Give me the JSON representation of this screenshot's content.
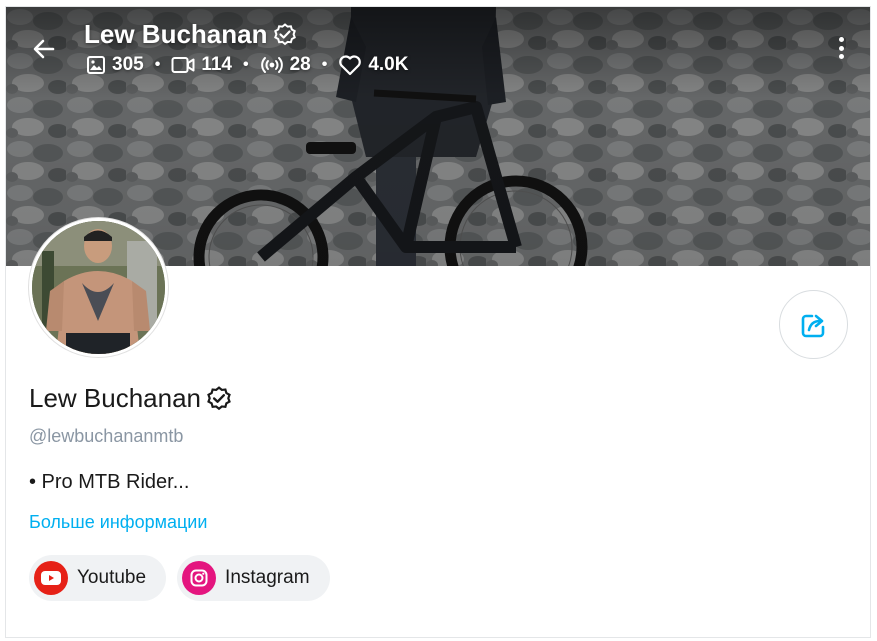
{
  "header": {
    "name": "Lew Buchanan",
    "stats": {
      "photos": "305",
      "videos": "114",
      "streams": "28",
      "likes": "4.0K"
    },
    "stat_separator": "•"
  },
  "profile": {
    "name": "Lew Buchanan",
    "handle": "@lewbuchananmtb",
    "bio": "• Pro MTB Rider...",
    "more_info": "Больше информации"
  },
  "socials": [
    {
      "label": "Youtube",
      "icon": "youtube-icon",
      "color": "#e62117"
    },
    {
      "label": "Instagram",
      "icon": "instagram-icon",
      "color": "#e4157f"
    }
  ],
  "colors": {
    "accent": "#00aff0",
    "muted": "#8a96a3",
    "text": "#1a1a1a"
  }
}
